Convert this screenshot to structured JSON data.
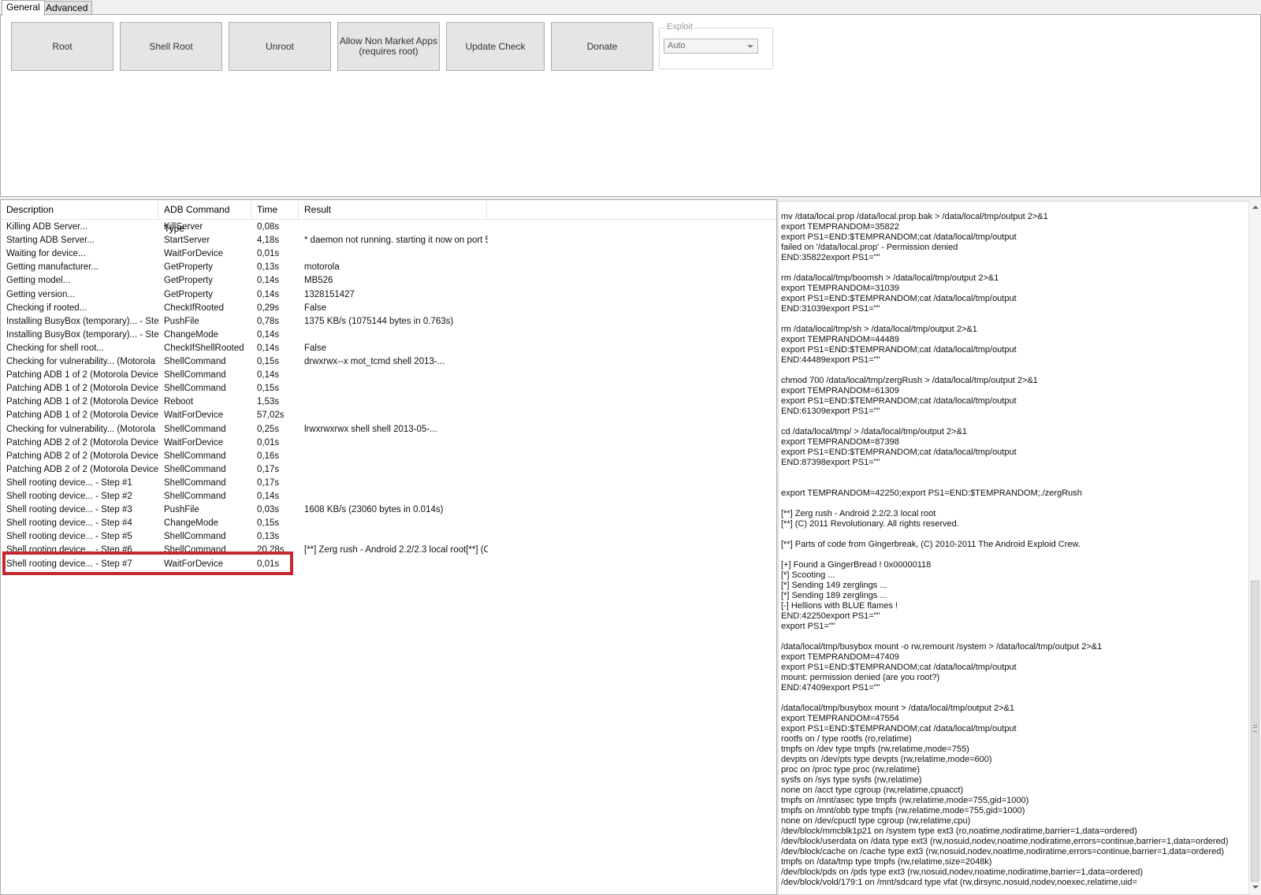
{
  "tabs": [
    {
      "label": "General",
      "active": true
    },
    {
      "label": "Advanced",
      "active": false
    }
  ],
  "toolbar": {
    "buttons": [
      {
        "label": "Root"
      },
      {
        "label": "Shell Root"
      },
      {
        "label": "Unroot"
      },
      {
        "label": "Allow Non Market Apps\n(requires root)"
      },
      {
        "label": "Update Check"
      },
      {
        "label": "Donate"
      }
    ],
    "exploit": {
      "legend": "Exploit",
      "selected": "Auto"
    }
  },
  "log_table": {
    "columns": [
      "Description",
      "ADB Command Type",
      "Time",
      "Result"
    ],
    "rows": [
      [
        "Killing ADB Server...",
        "KillServer",
        "0,08s",
        ""
      ],
      [
        "Starting ADB Server...",
        "StartServer",
        "4,18s",
        "* daemon not running. starting it now on port 5..."
      ],
      [
        "Waiting for device...",
        "WaitForDevice",
        "0,01s",
        ""
      ],
      [
        "Getting manufacturer...",
        "GetProperty",
        "0,13s",
        "motorola"
      ],
      [
        "Getting model...",
        "GetProperty",
        "0,14s",
        "MB526"
      ],
      [
        "Getting version...",
        "GetProperty",
        "0,14s",
        "1328151427"
      ],
      [
        "Checking if rooted...",
        "CheckIfRooted",
        "0,29s",
        "False"
      ],
      [
        "Installing BusyBox (temporary)... - Step...",
        "PushFile",
        "0,78s",
        "1375 KB/s (1075144 bytes in 0.763s)"
      ],
      [
        "Installing BusyBox (temporary)... - Step...",
        "ChangeMode",
        "0,14s",
        ""
      ],
      [
        "Checking for shell root...",
        "CheckIfShellRooted",
        "0,14s",
        "False"
      ],
      [
        "Checking for vulnerability... (Motorola ...",
        "ShellCommand",
        "0,15s",
        "drwxrwx--x mot_tcmd shell                    2013-..."
      ],
      [
        "Patching ADB 1 of 2 (Motorola Device...",
        "ShellCommand",
        "0,14s",
        ""
      ],
      [
        "Patching ADB 1 of 2 (Motorola Device...",
        "ShellCommand",
        "0,15s",
        ""
      ],
      [
        "Patching ADB 1 of 2 (Motorola Device...",
        "Reboot",
        "1,53s",
        ""
      ],
      [
        "Patching ADB 1 of 2 (Motorola Device...",
        "WaitForDevice",
        "57,02s",
        ""
      ],
      [
        "Checking for vulnerability... (Motorola ...",
        "ShellCommand",
        "0,25s",
        "lrwxrwxrwx shell    shell                    2013-05-..."
      ],
      [
        "Patching ADB 2 of 2 (Motorola Device...",
        "WaitForDevice",
        "0,01s",
        ""
      ],
      [
        "Patching ADB 2 of 2 (Motorola Device...",
        "ShellCommand",
        "0,16s",
        ""
      ],
      [
        "Patching ADB 2 of 2 (Motorola Device...",
        "ShellCommand",
        "0,17s",
        ""
      ],
      [
        "Shell rooting device... - Step #1",
        "ShellCommand",
        "0,17s",
        ""
      ],
      [
        "Shell rooting device... - Step #2",
        "ShellCommand",
        "0,14s",
        ""
      ],
      [
        "Shell rooting device... - Step #3",
        "PushFile",
        "0,03s",
        "1608 KB/s (23060 bytes in 0.014s)"
      ],
      [
        "Shell rooting device... - Step #4",
        "ChangeMode",
        "0,15s",
        ""
      ],
      [
        "Shell rooting device... - Step #5",
        "ShellCommand",
        "0,13s",
        ""
      ],
      [
        "Shell rooting device... - Step #6",
        "ShellCommand",
        "20,28s",
        "[**] Zerg rush - Android 2.2/2.3 local root[**] (C..."
      ],
      [
        "Shell rooting device... - Step #7",
        "WaitForDevice",
        "0,01s",
        ""
      ]
    ]
  },
  "highlight_color": "#c5282e",
  "console_output": "mv /data/local.prop /data/local.prop.bak > /data/local/tmp/output 2>&1\nexport TEMPRANDOM=35822\nexport PS1=END:$TEMPRANDOM;cat /data/local/tmp/output\nfailed on '/data/local.prop' - Permission denied\nEND:35822export PS1=\"\"\n\nrm /data/local/tmp/boomsh > /data/local/tmp/output 2>&1\nexport TEMPRANDOM=31039\nexport PS1=END:$TEMPRANDOM;cat /data/local/tmp/output\nEND:31039export PS1=\"\"\n\nrm /data/local/tmp/sh > /data/local/tmp/output 2>&1\nexport TEMPRANDOM=44489\nexport PS1=END:$TEMPRANDOM;cat /data/local/tmp/output\nEND:44489export PS1=\"\"\n\nchmod 700 /data/local/tmp/zergRush > /data/local/tmp/output 2>&1\nexport TEMPRANDOM=61309\nexport PS1=END:$TEMPRANDOM;cat /data/local/tmp/output\nEND:61309export PS1=\"\"\n\ncd /data/local/tmp/ > /data/local/tmp/output 2>&1\nexport TEMPRANDOM=87398\nexport PS1=END:$TEMPRANDOM;cat /data/local/tmp/output\nEND:87398export PS1=\"\"\n\n\nexport TEMPRANDOM=42250;export PS1=END:$TEMPRANDOM;./zergRush\n\n[**] Zerg rush - Android 2.2/2.3 local root\n[**] (C) 2011 Revolutionary. All rights reserved.\n\n[**] Parts of code from Gingerbreak, (C) 2010-2011 The Android Exploid Crew.\n\n[+] Found a GingerBread ! 0x00000118\n[*] Scooting ...\n[*] Sending 149 zerglings ...\n[*] Sending 189 zerglings ...\n[-] Hellions with BLUE flames !\nEND:42250export PS1=\"\"\nexport PS1=\"\"\n\n/data/local/tmp/busybox mount -o rw,remount /system > /data/local/tmp/output 2>&1\nexport TEMPRANDOM=47409\nexport PS1=END:$TEMPRANDOM;cat /data/local/tmp/output\nmount: permission denied (are you root?)\nEND:47409export PS1=\"\"\n\n/data/local/tmp/busybox mount > /data/local/tmp/output 2>&1\nexport TEMPRANDOM=47554\nexport PS1=END:$TEMPRANDOM;cat /data/local/tmp/output\nrootfs on / type rootfs (ro,relatime)\ntmpfs on /dev type tmpfs (rw,relatime,mode=755)\ndevpts on /dev/pts type devpts (rw,relatime,mode=600)\nproc on /proc type proc (rw,relatime)\nsysfs on /sys type sysfs (rw,relatime)\nnone on /acct type cgroup (rw,relatime,cpuacct)\ntmpfs on /mnt/asec type tmpfs (rw,relatime,mode=755,gid=1000)\ntmpfs on /mnt/obb type tmpfs (rw,relatime,mode=755,gid=1000)\nnone on /dev/cpuctl type cgroup (rw,relatime,cpu)\n/dev/block/mmcblk1p21 on /system type ext3 (ro,noatime,nodiratime,barrier=1,data=ordered)\n/dev/block/userdata on /data type ext3 (rw,nosuid,nodev,noatime,nodiratime,errors=continue,barrier=1,data=ordered)\n/dev/block/cache on /cache type ext3 (rw,nosuid,nodev,noatime,nodiratime,errors=continue,barrier=1,data=ordered)\ntmpfs on /data/tmp type tmpfs (rw,relatime,size=2048k)\n/dev/block/pds on /pds type ext3 (rw,nosuid,nodev,noatime,nodiratime,barrier=1,data=ordered)\n/dev/block/vold/179:1 on /mnt/sdcard type vfat (rw,dirsync,nosuid,nodev,noexec,relatime,uid="
}
